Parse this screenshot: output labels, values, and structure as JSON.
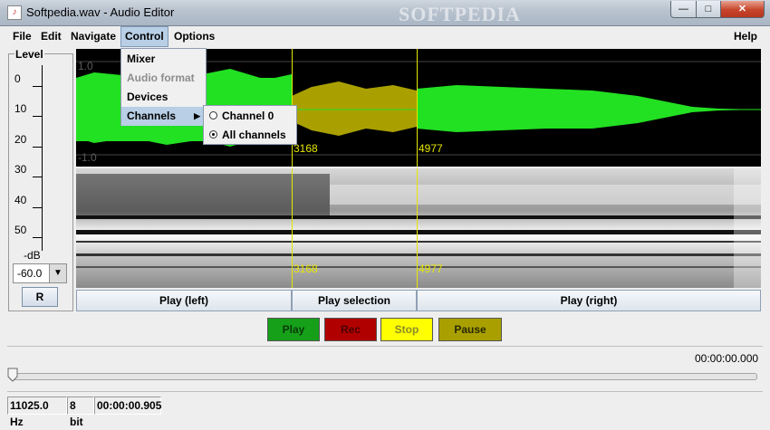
{
  "window": {
    "title": "Softpedia.wav - Audio Editor",
    "watermark": "SOFTPEDIA",
    "minimize": "—",
    "maximize": "□",
    "close": "✕"
  },
  "menubar": {
    "items": [
      "File",
      "Edit",
      "Navigate",
      "Control",
      "Options"
    ],
    "help": "Help",
    "active": "Control"
  },
  "control_menu": {
    "items": [
      {
        "label": "Mixer",
        "enabled": true
      },
      {
        "label": "Audio format",
        "enabled": false
      },
      {
        "label": "Devices",
        "enabled": true
      },
      {
        "label": "Channels",
        "enabled": true,
        "submenu": true,
        "highlighted": true
      }
    ]
  },
  "channels_submenu": {
    "items": [
      {
        "label": "Channel 0",
        "selected": false
      },
      {
        "label": "All channels",
        "selected": true
      }
    ]
  },
  "level": {
    "legend": "Level",
    "ticks": [
      "0",
      "10",
      "20",
      "30",
      "40",
      "50"
    ],
    "unit": "-dB",
    "value": "-60.0",
    "reset_label": "R"
  },
  "waveform": {
    "ymax": "1.0",
    "ymin": "-1.0"
  },
  "selection": {
    "start": "3168",
    "end": "4977",
    "spec_start": "3168",
    "spec_end": "4977"
  },
  "play_buttons": {
    "left": "Play (left)",
    "selection": "Play selection",
    "right": "Play (right)"
  },
  "transport": {
    "play": "Play",
    "rec": "Rec",
    "stop": "Stop",
    "pause": "Pause",
    "colors": {
      "play": "#16a01a",
      "rec": "#b10000",
      "stop": "#ffff00",
      "pause": "#a9a000"
    }
  },
  "time_display": "00:00:00.000",
  "status": {
    "sample_rate": "11025.0 Hz",
    "bits": "8 bit",
    "duration": "00:00:00.905"
  },
  "colors": {
    "wave": "#22e022",
    "selection": "#a9a000",
    "marker": "#e6e600"
  }
}
